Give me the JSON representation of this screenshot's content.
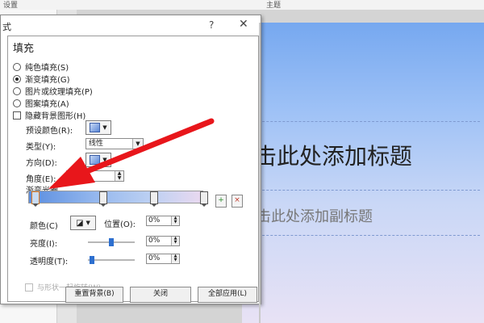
{
  "topbar": {
    "left_label": "设置",
    "center_label": "主题"
  },
  "dialog": {
    "title": "式",
    "help": "?",
    "close": "✕",
    "fill_section": "填充",
    "fill_options": [
      {
        "label": "纯色填充(S)",
        "selected": false
      },
      {
        "label": "渐变填充(G)",
        "selected": true
      },
      {
        "label": "图片或纹理填充(P)",
        "selected": false
      },
      {
        "label": "图案填充(A)",
        "selected": false
      }
    ],
    "hide_bg_label": "隐藏背景图形(H)",
    "preset_label": "预设颜色(R):",
    "type_label": "类型(Y):",
    "type_value": "线性",
    "direction_label": "方向(D):",
    "angle_label": "角度(E):",
    "gradient_stops_label": "渐变光圈",
    "color_label": "颜色(C)",
    "position_label": "位置(O):",
    "position_value": "0%",
    "brightness_label": "亮度(I):",
    "brightness_value": "0%",
    "transparency_label": "透明度(T):",
    "transparency_value": "0%",
    "rotate_label": "与形状一起旋转(W)",
    "reset_button": "重置背景(B)",
    "close_button": "关闭",
    "apply_all_button": "全部应用(L)"
  },
  "slide": {
    "title_placeholder": "击此处添加标题",
    "subtitle_placeholder": "击此处添加副标题"
  },
  "colors": {
    "accent": "#2d6fcf",
    "arrow": "#e8161b",
    "selected_stop_border": "#e07b22"
  }
}
